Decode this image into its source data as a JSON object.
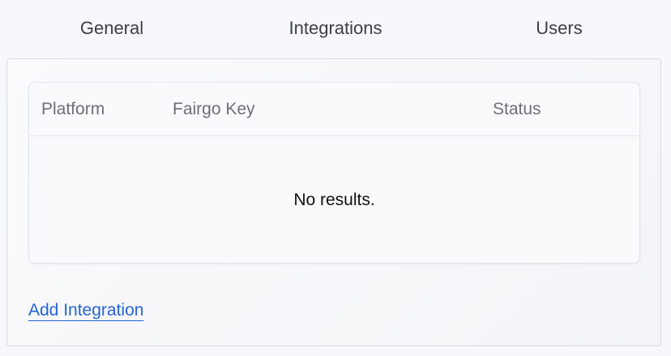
{
  "tabs": [
    {
      "label": "General"
    },
    {
      "label": "Integrations"
    },
    {
      "label": "Users"
    }
  ],
  "table": {
    "columns": [
      "Platform",
      "Fairgo Key",
      "Status"
    ],
    "empty_message": "No results."
  },
  "actions": {
    "add_integration": "Add Integration"
  },
  "colors": {
    "link": "#2563d9",
    "header_text": "#6b7079",
    "border": "#d7dbe2"
  }
}
